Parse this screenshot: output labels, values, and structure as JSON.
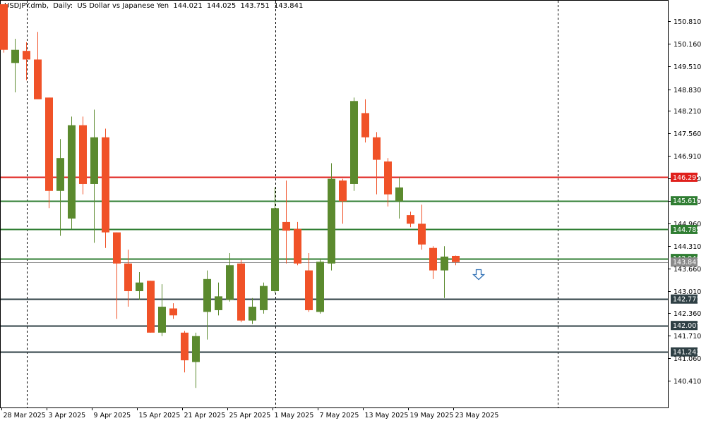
{
  "header": {
    "symbol": "USDJPY.dmb,",
    "timeframe": "Daily:",
    "description": "US Dollar vs Japanese Yen",
    "open": "144.021",
    "high": "144.025",
    "low": "143.751",
    "close": "143.841"
  },
  "colors": {
    "bull": "#5b8a2e",
    "bear": "#f05228",
    "resistance": "#e0201c",
    "support_green": "#2f7d32",
    "support_dark": "#2e3f44",
    "price_line": "#8a8a8a",
    "arrow": "#2e6fb5"
  },
  "chart_data": {
    "type": "candlestick",
    "symbol": "USDJPY",
    "ylim": [
      139.85,
      151.2
    ],
    "y_ticks": [
      "150.810",
      "150.160",
      "149.510",
      "148.830",
      "148.210",
      "147.560",
      "146.910",
      "146.260",
      "145.610",
      "144.960",
      "144.310",
      "143.660",
      "143.010",
      "142.360",
      "141.710",
      "141.060",
      "140.410"
    ],
    "x_labels": [
      {
        "label": "28 Mar 2025",
        "index": 0
      },
      {
        "label": "3 Apr 2025",
        "index": 4
      },
      {
        "label": "9 Apr 2025",
        "index": 8
      },
      {
        "label": "15 Apr 2025",
        "index": 12
      },
      {
        "label": "21 Apr 2025",
        "index": 16
      },
      {
        "label": "25 Apr 2025",
        "index": 20
      },
      {
        "label": "1 May 2025",
        "index": 24
      },
      {
        "label": "7 May 2025",
        "index": 28
      },
      {
        "label": "13 May 2025",
        "index": 32
      },
      {
        "label": "19 May 2025",
        "index": 36
      },
      {
        "label": "23 May 2025",
        "index": 40
      }
    ],
    "period_separators": [
      2,
      24,
      49
    ],
    "candles": [
      {
        "o": 151.3,
        "h": 151.3,
        "l": 149.9,
        "c": 149.98
      },
      {
        "o": 149.6,
        "h": 150.3,
        "l": 148.75,
        "c": 149.98
      },
      {
        "o": 149.95,
        "h": 150.2,
        "l": 149.1,
        "c": 149.7
      },
      {
        "o": 149.7,
        "h": 150.5,
        "l": 148.6,
        "c": 148.55
      },
      {
        "o": 148.6,
        "h": 148.6,
        "l": 145.4,
        "c": 145.9
      },
      {
        "o": 145.9,
        "h": 147.4,
        "l": 144.6,
        "c": 146.85
      },
      {
        "o": 145.1,
        "h": 148.05,
        "l": 144.8,
        "c": 147.8
      },
      {
        "o": 147.8,
        "h": 148.05,
        "l": 145.8,
        "c": 146.1
      },
      {
        "o": 146.1,
        "h": 148.25,
        "l": 144.4,
        "c": 147.45
      },
      {
        "o": 147.45,
        "h": 147.7,
        "l": 144.25,
        "c": 144.7
      },
      {
        "o": 144.7,
        "h": 144.7,
        "l": 142.2,
        "c": 143.8
      },
      {
        "o": 143.8,
        "h": 144.2,
        "l": 142.55,
        "c": 143.0
      },
      {
        "o": 143.0,
        "h": 143.55,
        "l": 142.75,
        "c": 143.25
      },
      {
        "o": 143.3,
        "h": 143.3,
        "l": 141.8,
        "c": 141.8
      },
      {
        "o": 141.8,
        "h": 143.2,
        "l": 141.7,
        "c": 142.55
      },
      {
        "o": 142.5,
        "h": 142.65,
        "l": 142.2,
        "c": 142.3
      },
      {
        "o": 141.8,
        "h": 141.85,
        "l": 140.65,
        "c": 141.0
      },
      {
        "o": 140.95,
        "h": 141.8,
        "l": 140.2,
        "c": 141.7
      },
      {
        "o": 142.4,
        "h": 143.6,
        "l": 141.6,
        "c": 143.35
      },
      {
        "o": 142.45,
        "h": 143.25,
        "l": 142.3,
        "c": 142.85
      },
      {
        "o": 142.75,
        "h": 144.1,
        "l": 142.7,
        "c": 143.75
      },
      {
        "o": 143.8,
        "h": 143.9,
        "l": 142.1,
        "c": 142.15
      },
      {
        "o": 142.15,
        "h": 142.8,
        "l": 142.05,
        "c": 142.55
      },
      {
        "o": 142.45,
        "h": 143.25,
        "l": 142.35,
        "c": 143.15
      },
      {
        "o": 143.0,
        "h": 146.0,
        "l": 142.95,
        "c": 145.4
      },
      {
        "o": 145.0,
        "h": 146.2,
        "l": 143.8,
        "c": 144.75
      },
      {
        "o": 144.8,
        "h": 145.0,
        "l": 143.75,
        "c": 143.8
      },
      {
        "o": 143.6,
        "h": 144.1,
        "l": 142.4,
        "c": 142.45
      },
      {
        "o": 142.4,
        "h": 143.95,
        "l": 142.35,
        "c": 143.85
      },
      {
        "o": 143.8,
        "h": 146.7,
        "l": 143.6,
        "c": 146.25
      },
      {
        "o": 146.2,
        "h": 146.25,
        "l": 144.95,
        "c": 145.6
      },
      {
        "o": 146.1,
        "h": 148.6,
        "l": 145.9,
        "c": 148.5
      },
      {
        "o": 148.15,
        "h": 148.55,
        "l": 147.3,
        "c": 147.45
      },
      {
        "o": 147.45,
        "h": 147.6,
        "l": 145.8,
        "c": 146.8
      },
      {
        "o": 146.75,
        "h": 146.85,
        "l": 145.45,
        "c": 145.8
      },
      {
        "o": 145.6,
        "h": 146.3,
        "l": 145.1,
        "c": 146.0
      },
      {
        "o": 145.2,
        "h": 145.3,
        "l": 144.85,
        "c": 144.95
      },
      {
        "o": 144.95,
        "h": 145.5,
        "l": 144.2,
        "c": 144.35
      },
      {
        "o": 144.25,
        "h": 144.3,
        "l": 143.35,
        "c": 143.6
      },
      {
        "o": 143.6,
        "h": 144.3,
        "l": 142.8,
        "c": 144.0
      },
      {
        "o": 144.02,
        "h": 144.03,
        "l": 143.75,
        "c": 143.84
      }
    ],
    "hlines": [
      {
        "label": "146.295",
        "value": 146.295,
        "color": "#e0201c"
      },
      {
        "label": "145.616",
        "value": 145.616,
        "color": "#2f7d32"
      },
      {
        "label": "144.785",
        "value": 144.785,
        "color": "#2f7d32"
      },
      {
        "label": "143.946",
        "value": 143.946,
        "color": "#2f7d32"
      },
      {
        "label": "143.841",
        "value": 143.841,
        "color": "#8a8a8a"
      },
      {
        "label": "142.771",
        "value": 142.771,
        "color": "#2e3f44"
      },
      {
        "label": "142.007",
        "value": 142.007,
        "color": "#2e3f44"
      },
      {
        "label": "141.243",
        "value": 141.243,
        "color": "#2e3f44"
      }
    ],
    "signal": {
      "direction": "down",
      "index": 42,
      "value": 143.5
    }
  }
}
